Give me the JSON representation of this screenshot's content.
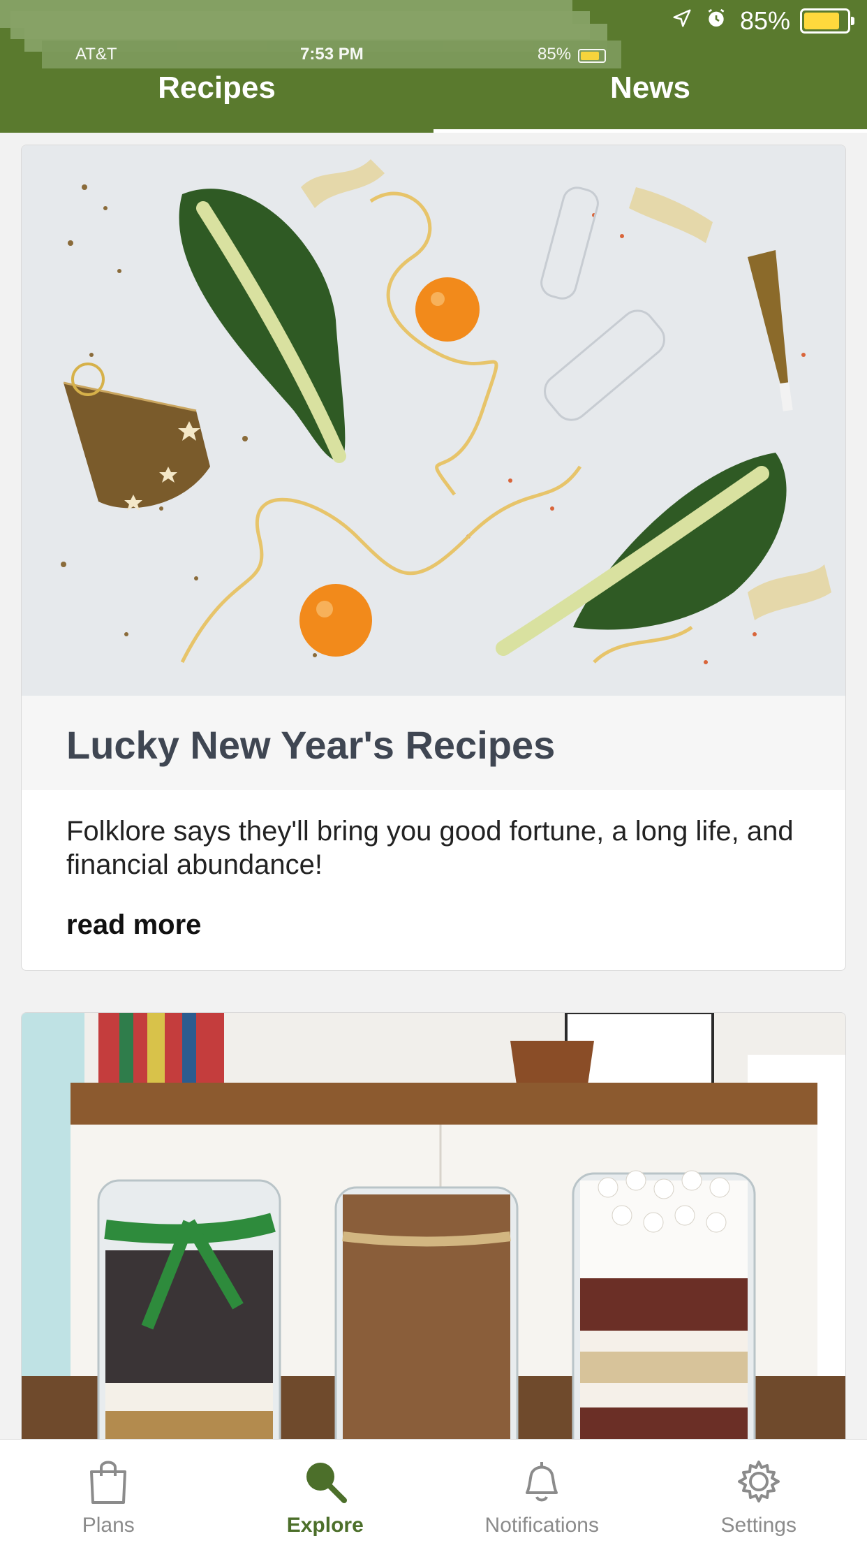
{
  "status_bar": {
    "carrier": "AT&T",
    "time": "7:53 PM",
    "battery_pct": "85%",
    "battery_color": "#ffd93d",
    "icons": [
      "wifi-icon",
      "location-arrow-icon",
      "alarm-clock-icon",
      "battery-icon"
    ]
  },
  "header": {
    "background": "#5a7a2e",
    "tabs": [
      {
        "label": "Recipes"
      },
      {
        "label": "News"
      }
    ]
  },
  "cards": [
    {
      "image_alt": "Lucky New Year's food ingredients",
      "title": "Lucky New Year's Recipes",
      "description": "Folklore says they'll bring you good fortune, a long life, and financial abundance!",
      "read_more": "read more"
    },
    {
      "image_alt": "Jar gift recipes"
    }
  ],
  "bottom_nav": {
    "items": [
      {
        "label": "Plans",
        "icon": "shopping-bag-icon",
        "active": false
      },
      {
        "label": "Explore",
        "icon": "search-icon",
        "active": true
      },
      {
        "label": "Notifications",
        "icon": "bell-icon",
        "active": false
      },
      {
        "label": "Settings",
        "icon": "gear-icon",
        "active": false
      }
    ],
    "active_color": "#4c6f2a",
    "inactive_color": "#8b8b8b"
  }
}
